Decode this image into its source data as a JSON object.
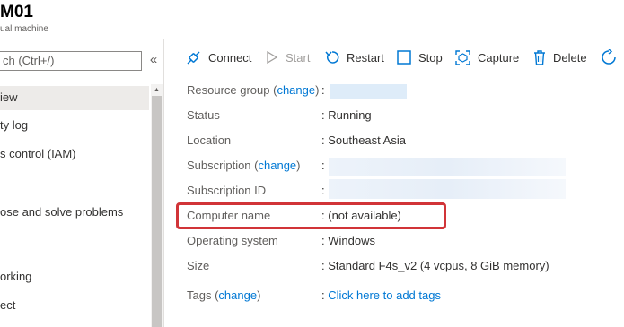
{
  "header": {
    "title": "M01",
    "subtitle": "ual machine"
  },
  "sidebar": {
    "search_placeholder": "ch (Ctrl+/)",
    "collapse_glyph": "«",
    "items": [
      {
        "label": "iew"
      },
      {
        "label": "ty log"
      },
      {
        "label": "s control (IAM)"
      },
      {
        "label": "ose and solve problems"
      },
      {
        "label": "orking"
      },
      {
        "label": "ect"
      }
    ]
  },
  "toolbar": {
    "connect": "Connect",
    "start": "Start",
    "restart": "Restart",
    "stop": "Stop",
    "capture": "Capture",
    "delete": "Delete"
  },
  "essentials": {
    "resource_group": {
      "label": "Resource group",
      "link": "change"
    },
    "status": {
      "label": "Status",
      "value": "Running"
    },
    "location": {
      "label": "Location",
      "value": "Southeast Asia"
    },
    "subscription": {
      "label": "Subscription",
      "link": "change"
    },
    "subscription_id": {
      "label": "Subscription ID"
    },
    "computer_name": {
      "label": "Computer name",
      "value": "(not available)"
    },
    "os": {
      "label": "Operating system",
      "value": "Windows"
    },
    "size": {
      "label": "Size",
      "value": "Standard F4s_v2 (4 vcpus, 8 GiB memory)"
    },
    "tags": {
      "label": "Tags",
      "link": "change",
      "value": "Click here to add tags"
    }
  },
  "colors": {
    "accent": "#0078d4",
    "highlight": "#d13438"
  }
}
